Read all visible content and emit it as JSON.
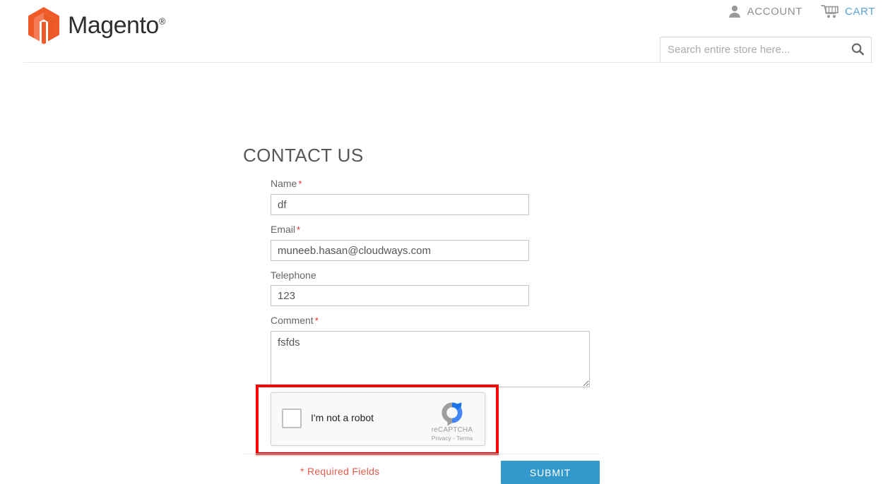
{
  "header": {
    "logo": {
      "brand": "Magento",
      "registered_mark": "®",
      "mark_icon": "magento-hexagon-logo",
      "color": "#f26322"
    },
    "links": [
      {
        "label": "ACCOUNT",
        "icon": "user-icon",
        "color": "#8f8f8f"
      },
      {
        "label": "CART",
        "icon": "shopping-cart-icon",
        "color": "#5ba2d4"
      }
    ],
    "search": {
      "placeholder": "Search entire store here...",
      "value": "",
      "button_icon": "search-icon"
    }
  },
  "main": {
    "page_title": "CONTACT US",
    "form": {
      "fields": [
        {
          "label": "Name",
          "required": true,
          "value": "df",
          "type": "text"
        },
        {
          "label": "Email",
          "required": true,
          "value": "muneeb.hasan@cloudways.com",
          "type": "email"
        },
        {
          "label": "Telephone",
          "required": false,
          "value": "123",
          "type": "tel"
        },
        {
          "label": "Comment",
          "required": true,
          "value": "fsfds",
          "type": "textarea"
        }
      ],
      "required_marker": "*"
    },
    "recaptcha": {
      "checkbox_label": "I'm not a robot",
      "brand_name": "reCAPTCHA",
      "terms_text": "Privacy - Terms",
      "logo_icon": "recaptcha-logo-icon",
      "checked": false,
      "highlight_color": "#ff0000"
    },
    "actions": {
      "required_fields_note": "* Required Fields",
      "submit_label": "SUBMIT",
      "submit_color": "#3399cc",
      "required_note_color": "#e35b4c"
    }
  }
}
